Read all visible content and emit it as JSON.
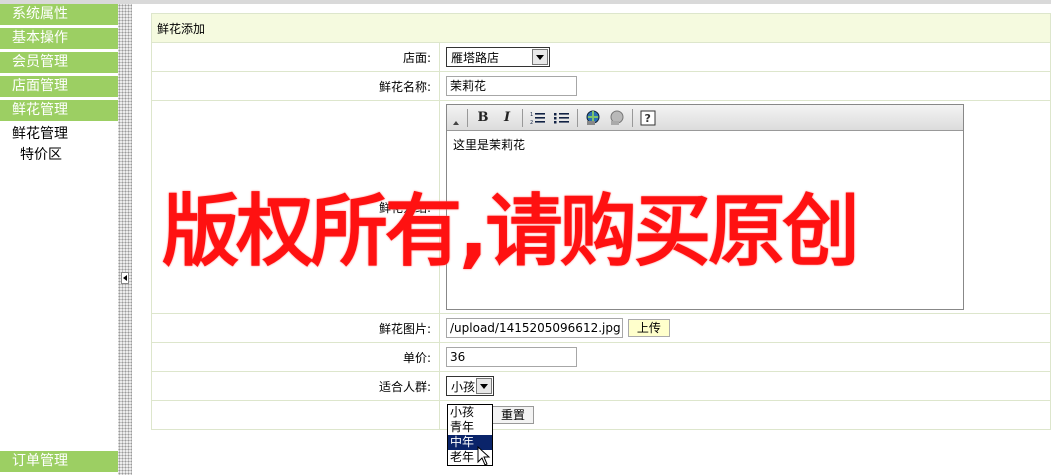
{
  "sidebar": {
    "menus": [
      "系统属性",
      "基本操作",
      "会员管理",
      "店面管理",
      "鲜花管理"
    ],
    "submenus": [
      "鲜花管理",
      "特价区"
    ],
    "bottom_menu": "订单管理"
  },
  "form": {
    "title": "鲜花添加",
    "store_label": "店面:",
    "store_value": "雁塔路店",
    "name_label": "鲜花名称:",
    "name_value": "茉莉花",
    "desc_label": "鲜花介绍:",
    "desc_content": "这里是茉莉花",
    "image_label": "鲜花图片:",
    "image_value": "/upload/1415205096612.jpg",
    "upload_button": "上传",
    "price_label": "单价:",
    "price_value": "36",
    "audience_label": "适合人群:",
    "audience_value": "小孩",
    "audience_options": [
      "小孩",
      "青年",
      "中年",
      "老年"
    ],
    "reset_button": "重置"
  },
  "editor_toolbar": [
    "bold-icon",
    "italic-icon",
    "ordered-list-icon",
    "unordered-list-icon",
    "link-icon",
    "unlink-icon",
    "help-icon"
  ],
  "watermark": "版权所有,请购买原创",
  "colors": {
    "menu_bg": "#9ccf63",
    "header_bg": "#f5fadf",
    "watermark": "#ff1111",
    "selected_option": "#0a246a"
  }
}
